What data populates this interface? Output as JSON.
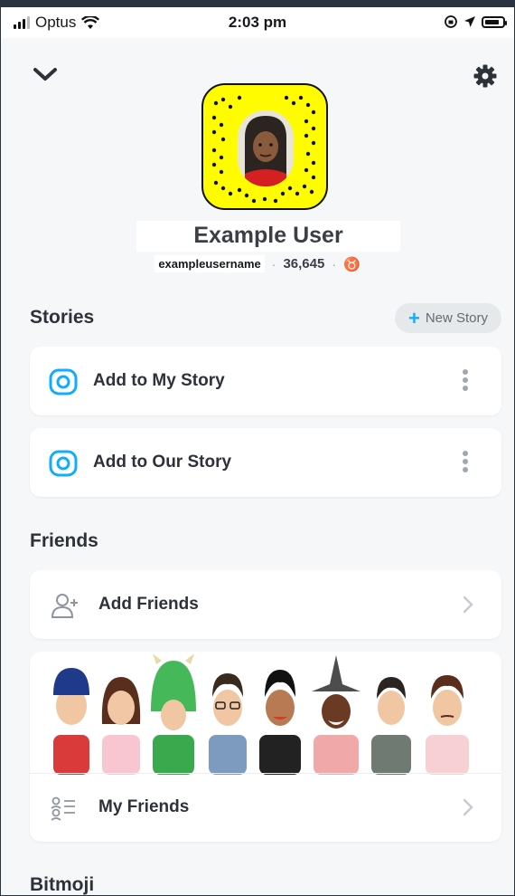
{
  "status_bar": {
    "carrier": "Optus",
    "time": "2:03 pm"
  },
  "header": {
    "back_icon": "chevron-down-icon",
    "settings_icon": "gear-icon"
  },
  "profile": {
    "display_name": "Example User",
    "username": "exampleusername",
    "snap_score": "36,645",
    "zodiac_symbol": "♉"
  },
  "stories": {
    "title": "Stories",
    "new_story_label": "New Story",
    "items": [
      {
        "label": "Add to My Story"
      },
      {
        "label": "Add to Our Story"
      }
    ]
  },
  "friends": {
    "title": "Friends",
    "add_friends_label": "Add Friends",
    "my_friends_label": "My Friends"
  },
  "bitmoji": {
    "title": "Bitmoji"
  },
  "colors": {
    "snap_yellow": "#FFFC00",
    "accent_blue": "#0FADFF",
    "background": "#F6F7F8"
  }
}
